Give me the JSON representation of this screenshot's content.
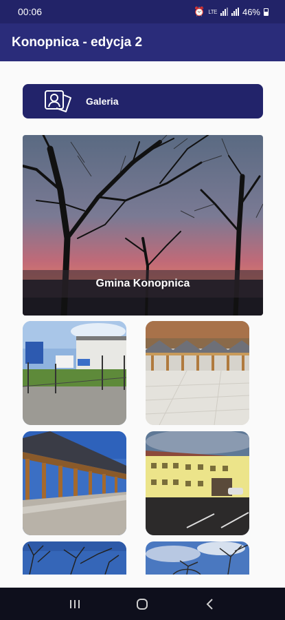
{
  "status_bar": {
    "time": "00:06",
    "network": "LTE",
    "battery": "46%"
  },
  "app_bar": {
    "title": "Konopnica - edycja 2"
  },
  "gallery_button": {
    "label": "Galeria",
    "icon": "gallery-person-card-icon"
  },
  "hero": {
    "caption": "Gmina Konopnica"
  },
  "colors": {
    "primary_dark": "#222368",
    "app_bar": "#2a2c7a",
    "background": "#fafafa",
    "nav_bar": "#0e0f1c"
  },
  "navigation": {
    "recents_icon": "recents-icon",
    "home_icon": "home-icon",
    "back_icon": "back-icon"
  }
}
